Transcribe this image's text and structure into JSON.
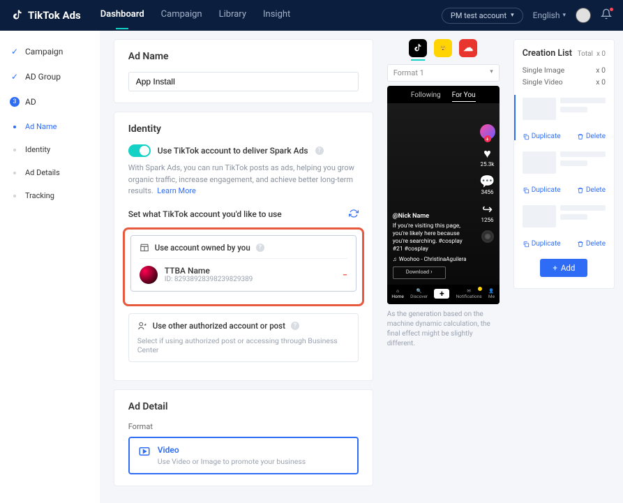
{
  "brand": "TikTok Ads",
  "nav": [
    "Dashboard",
    "Campaign",
    "Library",
    "Insight"
  ],
  "account_pill": "PM test account",
  "lang": "English",
  "sidebar": {
    "campaign": "Campaign",
    "adgroup": "AD Group",
    "ad": "AD",
    "ad_num": "3",
    "subs": [
      "Ad Name",
      "Identity",
      "Ad Details",
      "Tracking"
    ]
  },
  "adname": {
    "title": "Ad Name",
    "value": "App Install"
  },
  "identity": {
    "title": "Identity",
    "toggle_label": "Use TikTok account to deliver Spark Ads",
    "help": "With Spark Ads, you can run TikTok posts as ads, helping you grow organic traffic, increase engagement, and achieve better long-term results.",
    "learn_more": "Learn More",
    "set_label": "Set what TikTok account you'd like to use",
    "opt1_title": "Use account owned by you",
    "acct_name": "TTBA Name",
    "acct_id": "ID: 82938928398239829389",
    "opt2_title": "Use other authorized account or post",
    "opt2_sub": "Select if using authorized post or accessing through Business Center"
  },
  "detail": {
    "title": "Ad Detail",
    "format_label": "Format",
    "video": "Video",
    "video_sub": "Use Video or Image to promote your business"
  },
  "preview": {
    "format_select": "Format 1",
    "tab_following": "Following",
    "tab_foryou": "For You",
    "likes": "25.3k",
    "comments": "3456",
    "shares": "1256",
    "user": "@Nick Name",
    "caption": "If you're visiting this page, you're likely here because you're searching. #cosplay #21 #cosplay",
    "music": "Woohoo - ChristinaAguilera",
    "download": "Download",
    "bottom": [
      "Home",
      "Discover",
      "",
      "Notifications",
      "Me"
    ],
    "disclaimer": "As the generation based on the machine dynamic calculation, the final effect might be slightly different."
  },
  "creation": {
    "title": "Creation List",
    "total": "Total",
    "total_x": "x 0",
    "lines": [
      {
        "label": "Single Image",
        "count": "x 0"
      },
      {
        "label": "Single Video",
        "count": "x 0"
      }
    ],
    "dup": "Duplicate",
    "del": "Delete",
    "add": "Add"
  }
}
